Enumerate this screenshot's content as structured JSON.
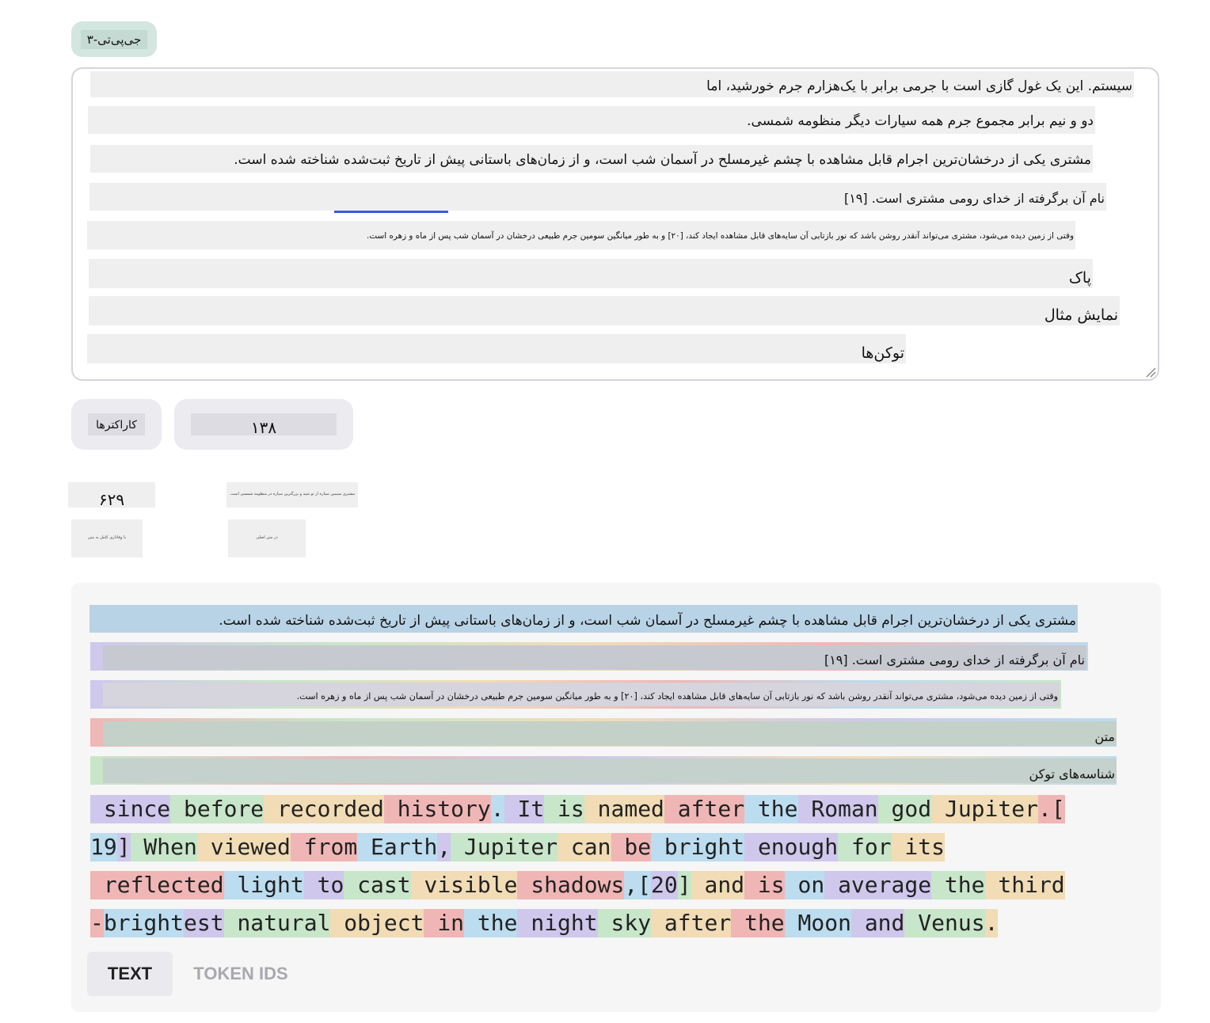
{
  "model": {
    "label": "جی‌پی‌تی-۳"
  },
  "input": {
    "lines": [
      "سیستم. این یک غول گازی است با جرمی برابر با یک‌هزارم جرم خورشید، اما",
      "دو و نیم برابر مجموع جرم همه سیارات دیگر منظومه شمسی.",
      "مشتری یکی از درخشان‌ترین اجرام قابل مشاهده با چشم غیرمسلح در آسمان شب است، و از زمان‌های باستانی پیش از تاریخ ثبت‌شده شناخته شده است.",
      "نام آن برگرفته از خدای رومی مشتری است. [۱۹]",
      "وقتی از زمین دیده می‌شود، مشتری می‌تواند آنقدر روشن باشد که نور بازتابی آن سایه‌های قابل مشاهده ایجاد کند، [۲۰] و به طور میانگین سومین جرم طبیعی درخشان در آسمان شب پس از ماه و زهره است.",
      "پاک",
      "نمایش مثال",
      "توکن‌ها"
    ]
  },
  "stats": {
    "tokens_value": "۱۳۸",
    "characters_label": "کاراکترها",
    "characters_value": "۶۲۹",
    "tiny_notes": [
      "مشتری سیمین سیاره از تو شید و بزرگترین سیاره در منظومه شمسی است.",
      "با وفاداری کامل به متن",
      "در متن اصلی"
    ]
  },
  "output": {
    "overlay_lines": [
      "مشتری یکی از درخشان‌ترین اجرام قابل مشاهده با چشم غیرمسلح در آسمان شب است، و از زمان‌های باستانی پیش از تاریخ ثبت‌شده شناخته شده است.",
      "نام آن برگرفته از خدای رومی مشتری است. [۱۹]",
      "وقتی از زمین دیده می‌شود، مشتری می‌تواند آنقدر روشن باشد که نور بازتابی آن سایه‌های قابل مشاهده ایجاد کند، [۲۰] و به طور میانگین سومین جرم طبیعی درخشان در آسمان شب پس از ماه و زهره است.",
      "متن",
      "شناسه‌های توکن"
    ],
    "token_rows": [
      [
        " since",
        " before",
        " recorded",
        " history",
        ".",
        " It",
        " is",
        " named",
        " after",
        " the",
        " Roman",
        " god",
        " Jupiter",
        ".["
      ],
      [
        "19",
        "]",
        " When",
        " viewed",
        " from",
        " Earth",
        ",",
        " Jupiter",
        " can",
        " be",
        " bright",
        " enough",
        " for",
        " its"
      ],
      [
        " reflected",
        " light",
        " to",
        " cast",
        " visible",
        " shadows",
        ",[",
        "20",
        "]",
        " and",
        " is",
        " on",
        " average",
        " the",
        " third"
      ],
      [
        "-",
        "bright",
        "est",
        " natural",
        " object",
        " in",
        " the",
        " night",
        " sky",
        " after",
        " the",
        " Moon",
        " and",
        " Venus",
        "."
      ]
    ],
    "token_colors": [
      [
        0,
        1,
        2,
        3,
        4,
        0,
        1,
        2,
        3,
        4,
        0,
        1,
        2,
        3
      ],
      [
        4,
        0,
        1,
        2,
        3,
        4,
        0,
        1,
        2,
        3,
        4,
        0,
        1,
        2
      ],
      [
        3,
        4,
        0,
        1,
        2,
        3,
        4,
        0,
        1,
        2,
        3,
        4,
        0,
        1,
        2
      ],
      [
        3,
        4,
        0,
        1,
        2,
        3,
        4,
        0,
        1,
        2,
        3,
        4,
        0,
        1,
        2
      ]
    ],
    "tabs": {
      "text": "TEXT",
      "token_ids": "TOKEN IDS"
    }
  }
}
